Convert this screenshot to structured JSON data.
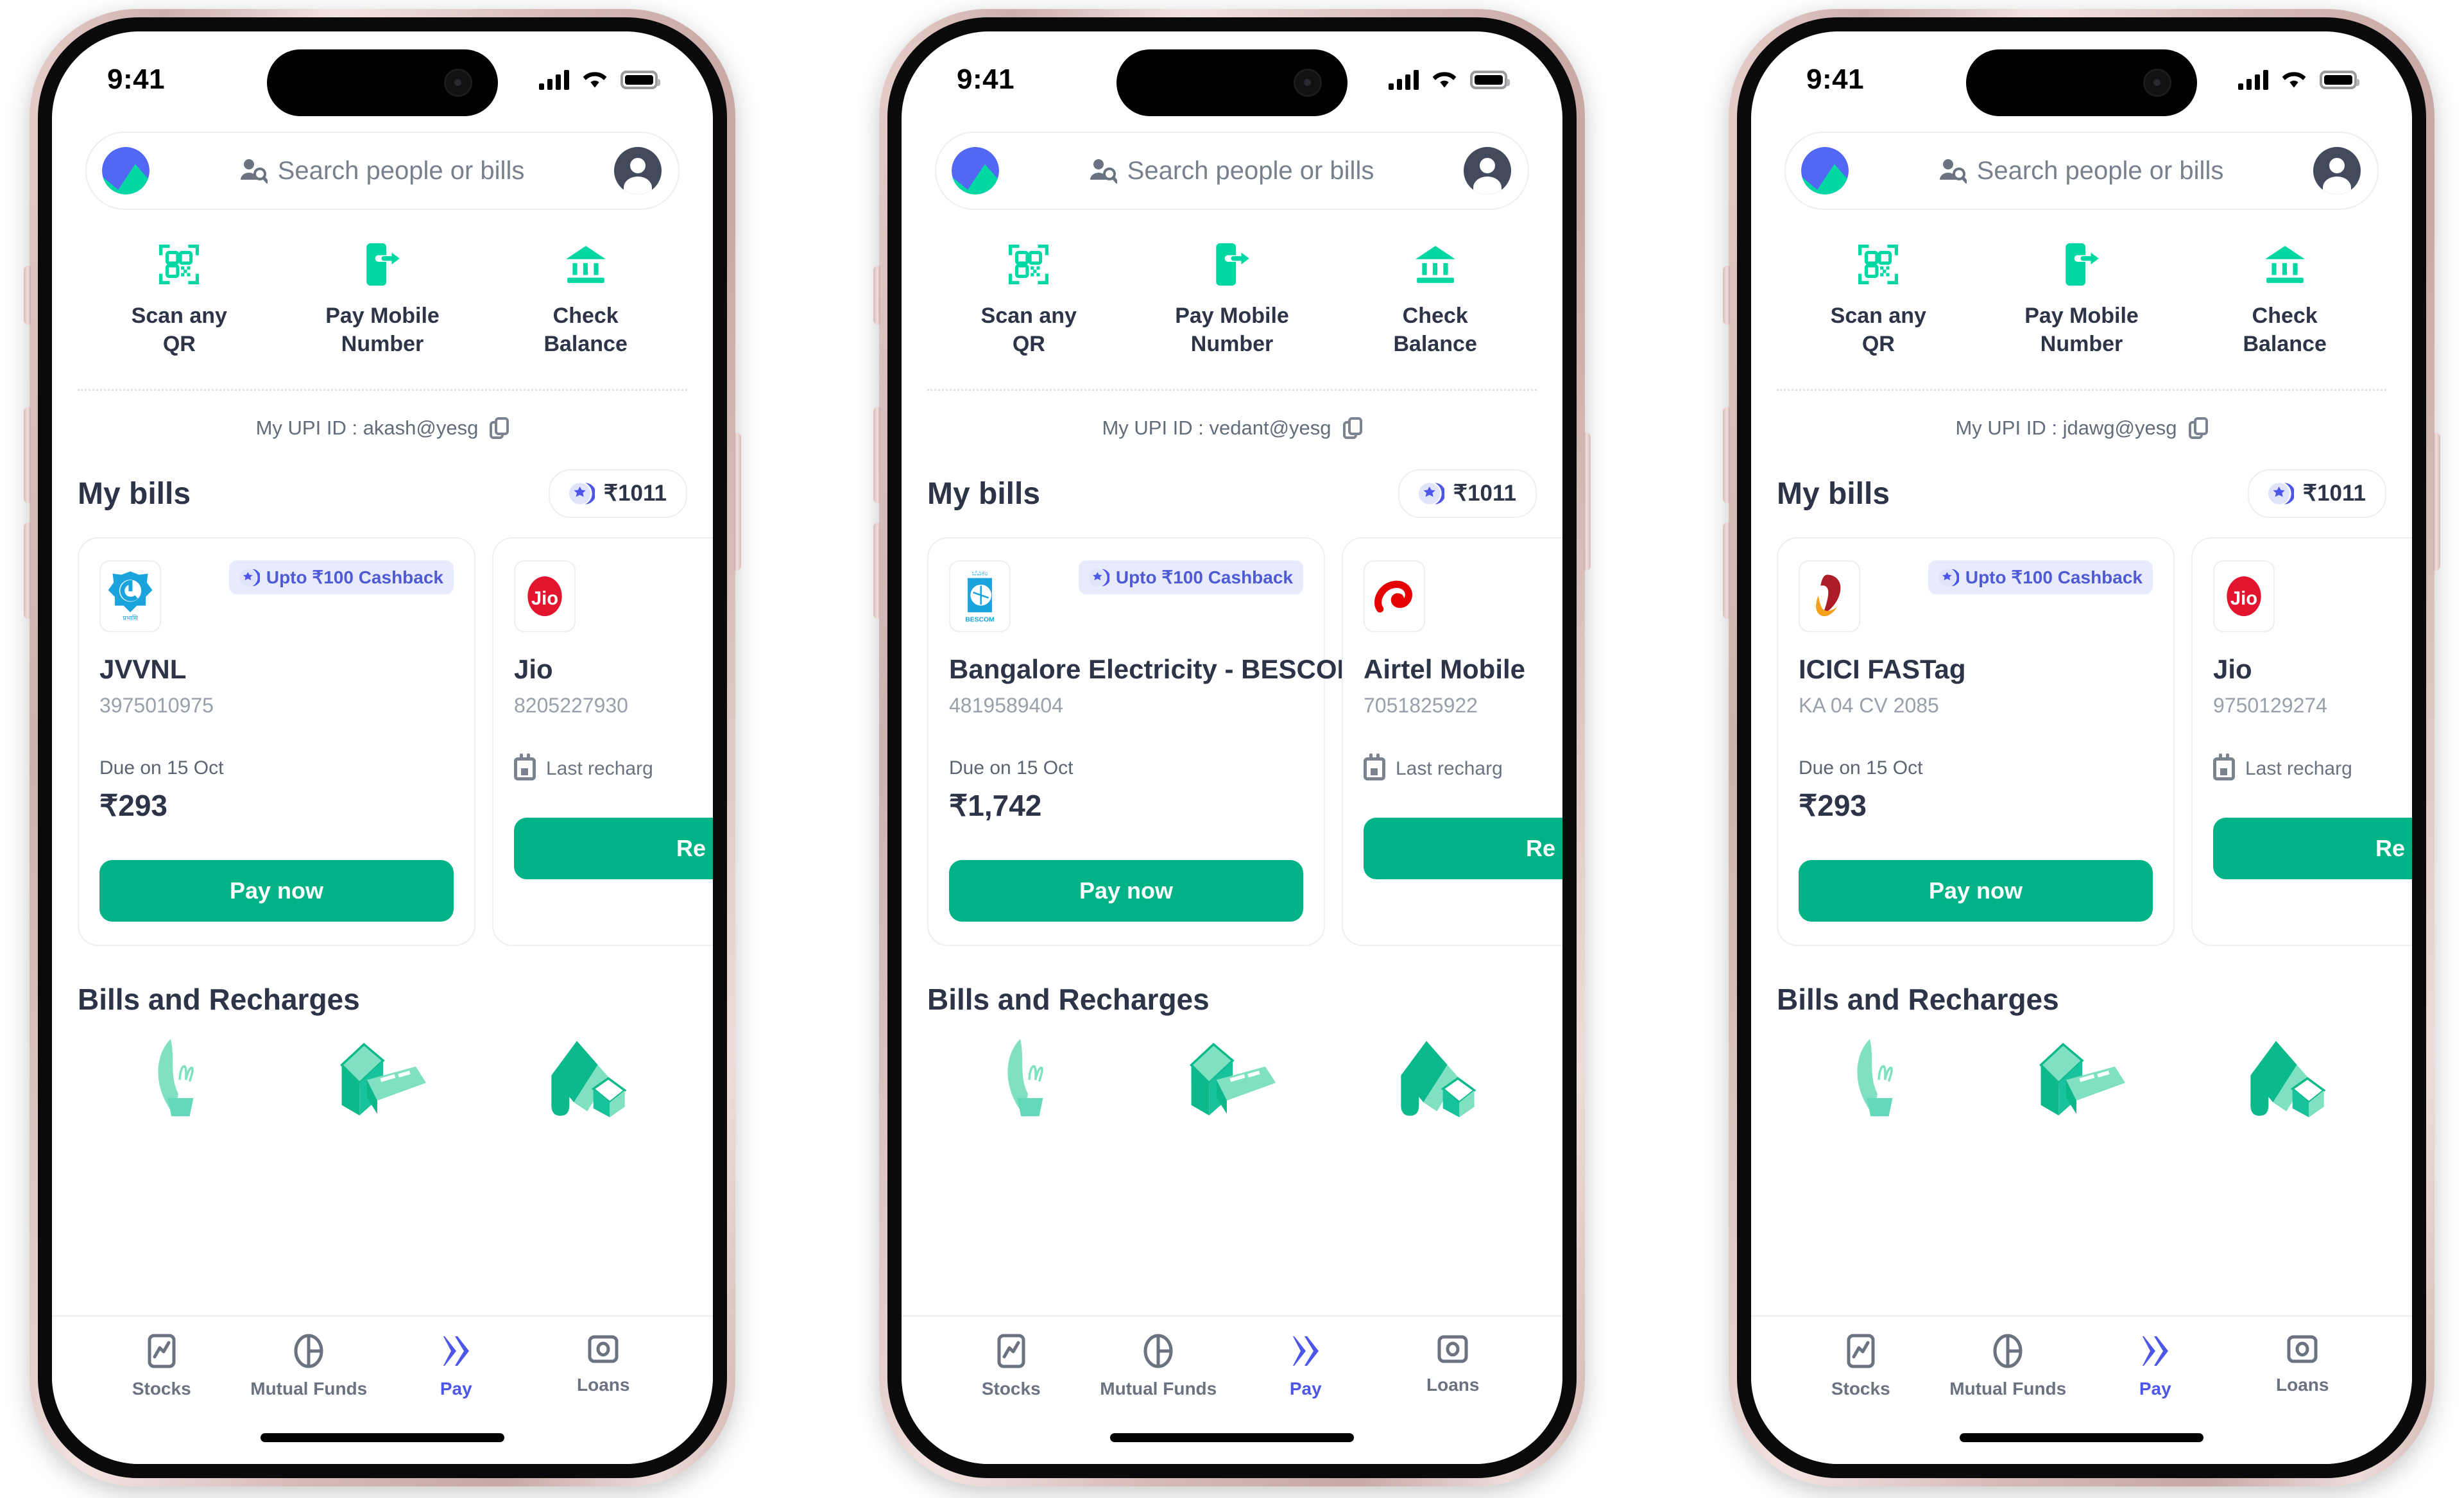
{
  "theme": {
    "green": "#00b386",
    "indigo": "#4c56e8",
    "badge_bg": "#e8eafd",
    "badge_text": "#4e5bd4",
    "text_dark": "#2d3447",
    "text_muted": "#9aa0ab",
    "frame": "#d6bab6"
  },
  "status_bar": {
    "time": "9:41",
    "signal_icon": "cellular-signal-icon",
    "wifi_icon": "wifi-icon",
    "battery_icon": "battery-full-icon"
  },
  "search": {
    "logo_icon": "groww-logo-icon",
    "search_person_icon": "person-search-icon",
    "placeholder": "Search people or bills",
    "avatar_icon": "user-avatar-icon"
  },
  "quick_actions": [
    {
      "icon": "qr-scan-icon",
      "label": "Scan any\nQR",
      "line1": "Scan any",
      "line2": "QR"
    },
    {
      "icon": "mobile-pay-icon",
      "label": "Pay Mobile\nNumber",
      "line1": "Pay Mobile",
      "line2": "Number"
    },
    {
      "icon": "bank-icon",
      "label": "Check\nBalance",
      "line1": "Check",
      "line2": "Balance"
    }
  ],
  "upi": {
    "label_prefix": "My UPI ID : ",
    "copy_icon": "copy-icon"
  },
  "bills_section": {
    "title": "My bills",
    "cashback_pill": {
      "icon": "cashback-coin-icon",
      "amount": "₹1011"
    },
    "cashback_badge": {
      "icon": "cashback-coin-icon",
      "text": "Upto ₹100 Cashback"
    },
    "due_label": "Due on 15 Oct",
    "last_recharge_label": "Last recharg",
    "last_recharge_icon": "calendar-icon",
    "pay_now_label": "Pay now",
    "recharge_label": "Re"
  },
  "bills_recharges": {
    "title": "Bills and Recharges",
    "illustrations": [
      "plant-hand-icon",
      "money-stack-icon",
      "house-paint-icon"
    ]
  },
  "tabbar": [
    {
      "icon": "stocks-chart-icon",
      "label": "Stocks",
      "active": false
    },
    {
      "icon": "pie-chart-icon",
      "label": "Mutual Funds",
      "active": false
    },
    {
      "icon": "pay-chevrons-icon",
      "label": "Pay",
      "active": true
    },
    {
      "icon": "loans-coin-icon",
      "label": "Loans",
      "active": false
    }
  ],
  "phones": [
    {
      "upi_id": "akash@yesg",
      "primary_bill": {
        "brand_logo_icon": "jvvnl-logo-icon",
        "name": "JVVNL",
        "account": "3975010975",
        "due": "Due on 15 Oct",
        "amount": "₹293",
        "cta": "Pay now"
      },
      "secondary_bill": {
        "brand_logo_icon": "jio-logo-icon",
        "name": "Jio",
        "account": "8205227930",
        "meta": "Last recharg",
        "cta": "Re"
      }
    },
    {
      "upi_id": "vedant@yesg",
      "primary_bill": {
        "brand_logo_icon": "bescom-logo-icon",
        "name": "Bangalore Electricity - BESCOM",
        "account": "4819589404",
        "due": "Due on 15 Oct",
        "amount": "₹1,742",
        "cta": "Pay now"
      },
      "secondary_bill": {
        "brand_logo_icon": "airtel-logo-icon",
        "name": "Airtel Mobile",
        "account": "7051825922",
        "meta": "Last recharg",
        "cta": "Re"
      }
    },
    {
      "upi_id": "jdawg@yesg",
      "primary_bill": {
        "brand_logo_icon": "icici-logo-icon",
        "name": "ICICI FASTag",
        "account": "KA 04 CV 2085",
        "due": "Due on 15 Oct",
        "amount": "₹293",
        "cta": "Pay now"
      },
      "secondary_bill": {
        "brand_logo_icon": "jio-logo-icon",
        "name": "Jio",
        "account": "9750129274",
        "meta": "Last recharg",
        "cta": "Re"
      }
    }
  ]
}
